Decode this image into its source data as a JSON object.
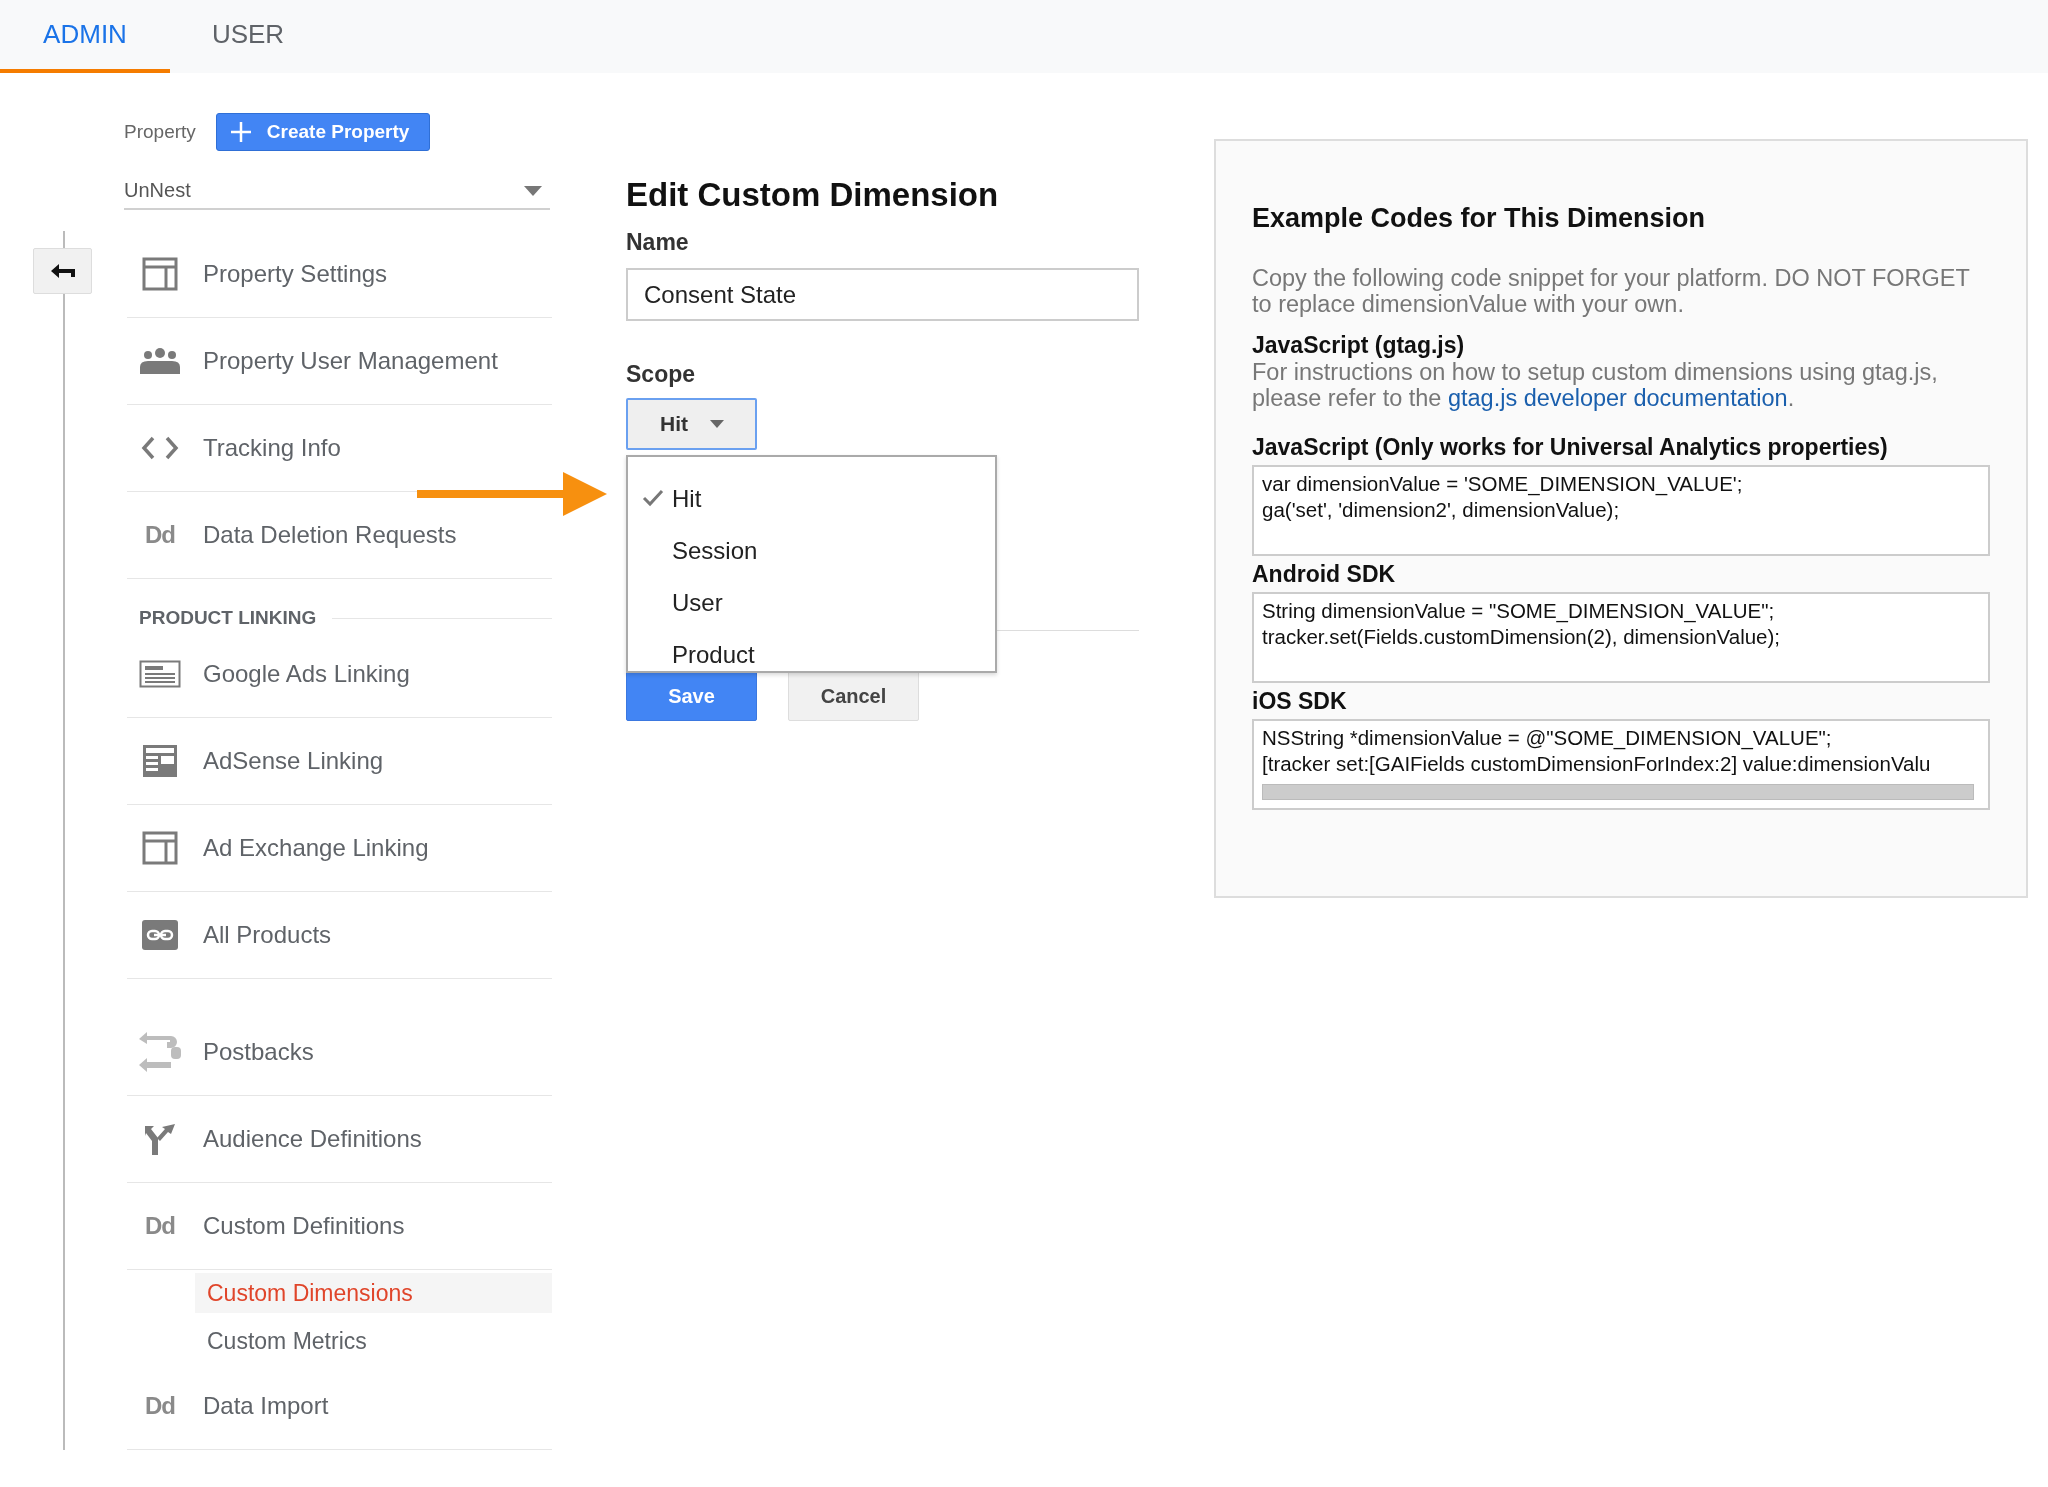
{
  "tabs": [
    {
      "label": "ADMIN",
      "selected": true
    },
    {
      "label": "USER",
      "selected": false
    }
  ],
  "property": {
    "label": "Property",
    "create_button": "Create Property",
    "select_value": "UnNest"
  },
  "nav": {
    "sections": [
      {
        "items": [
          {
            "label": "Property Settings"
          },
          {
            "label": "Property User Management"
          },
          {
            "label": "Tracking Info"
          },
          {
            "label": "Data Deletion Requests",
            "icon_text": "Dd"
          }
        ]
      },
      {
        "heading": "PRODUCT LINKING",
        "items": [
          {
            "label": "Google Ads Linking"
          },
          {
            "label": "AdSense Linking"
          },
          {
            "label": "Ad Exchange Linking"
          },
          {
            "label": "All Products"
          }
        ]
      },
      {
        "items": [
          {
            "label": "Postbacks"
          },
          {
            "label": "Audience Definitions"
          },
          {
            "label": "Custom Definitions",
            "icon_text": "Dd",
            "children": [
              {
                "label": "Custom Dimensions",
                "selected": true
              },
              {
                "label": "Custom Metrics",
                "selected": false
              }
            ]
          },
          {
            "label": "Data Import",
            "icon_text": "Dd"
          }
        ]
      }
    ]
  },
  "editor": {
    "title": "Edit Custom Dimension",
    "name_label": "Name",
    "name_value": "Consent State",
    "scope_label": "Scope",
    "scope_value": "Hit",
    "scope_options": [
      {
        "label": "Hit",
        "selected": true
      },
      {
        "label": "Session",
        "selected": false
      },
      {
        "label": "User",
        "selected": false
      },
      {
        "label": "Product",
        "selected": false
      }
    ],
    "save_button": "Save",
    "cancel_button": "Cancel"
  },
  "examples": {
    "title": "Example Codes for This Dimension",
    "intro": "Copy the following code snippet for your platform. DO NOT FORGET to replace dimensionValue with your own.",
    "sections": [
      {
        "kind": "note",
        "heading": "JavaScript (gtag.js)",
        "text": "For instructions on how to setup custom dimensions using gtag.js, please refer to the ",
        "link": "gtag.js developer documentation",
        "text_after": "."
      },
      {
        "kind": "code",
        "heading": "JavaScript (Only works for Universal Analytics properties)",
        "lines": [
          "var dimensionValue = 'SOME_DIMENSION_VALUE';",
          "ga('set', 'dimension2', dimensionValue);"
        ]
      },
      {
        "kind": "code",
        "heading": "Android SDK",
        "lines": [
          "String dimensionValue = \"SOME_DIMENSION_VALUE\";",
          "tracker.set(Fields.customDimension(2), dimensionValue);"
        ]
      },
      {
        "kind": "code",
        "heading": "iOS SDK",
        "lines": [
          "NSString *dimensionValue = @\"SOME_DIMENSION_VALUE\";",
          "[tracker set:[GAIFields customDimensionForIndex:2] value:dimensionValu"
        ],
        "horizontal_scrollbar": true
      }
    ]
  }
}
